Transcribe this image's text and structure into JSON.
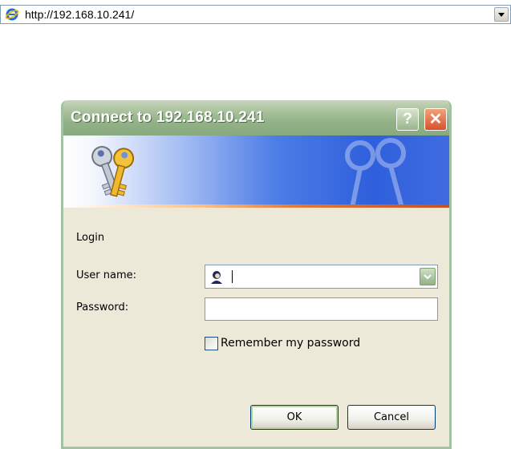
{
  "address_bar": {
    "url": "http://192.168.10.241/"
  },
  "dialog": {
    "title": "Connect to 192.168.10.241",
    "help_button": "?",
    "close_button": "✕",
    "login_label": "Login",
    "username_label": "User name:",
    "username_value": "",
    "password_label": "Password:",
    "password_value": "",
    "remember_label": "Remember my password",
    "remember_checked": false,
    "ok_label": "OK",
    "cancel_label": "Cancel"
  },
  "icons": {
    "browser": "ie-icon",
    "banner": "keys-icon",
    "user": "user-avatar-icon"
  },
  "colors": {
    "titlebar": "#93b287",
    "banner_blue": "#2f5fdb",
    "close_red": "#d8502c"
  }
}
